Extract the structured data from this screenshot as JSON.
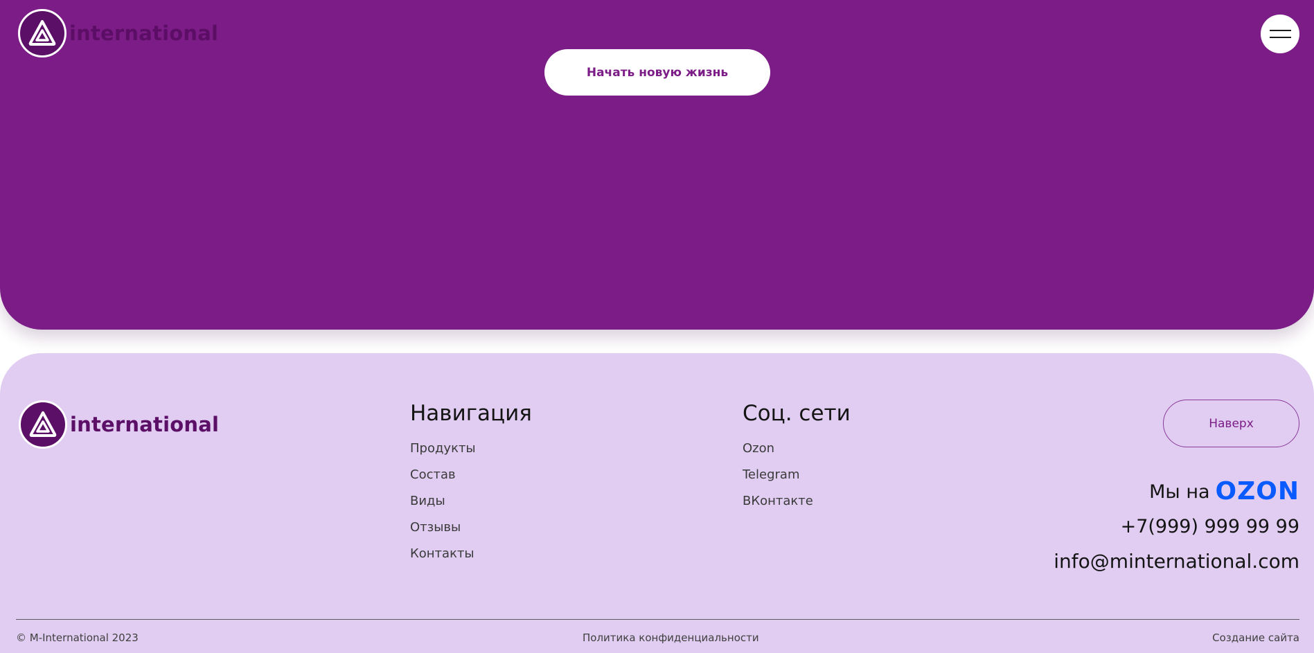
{
  "header": {
    "logo_text": "international",
    "menu_button_icon": "hamburger-icon"
  },
  "hero": {
    "cta_label": "Начать новую жизнь",
    "background_color": "#7c1d87"
  },
  "footer": {
    "logo_text": "international",
    "background_color": "#e0cdf1",
    "navigation": {
      "title": "Навигация",
      "items": [
        "Продукты",
        "Состав",
        "Виды",
        "Отзывы",
        "Контакты"
      ]
    },
    "social": {
      "title": "Соц. сети",
      "items": [
        "Ozon",
        "Telegram",
        "ВКонтакте"
      ]
    },
    "top_button_label": "Наверх",
    "ozon_prefix": "Мы на",
    "ozon_logo_text": "OZON",
    "phone": "+7(999) 999 99 99",
    "email": "info@minternational.com",
    "copyright": "© M-International 2023",
    "privacy_link": "Политика конфиденциальности",
    "site_credit": "Создание сайта"
  }
}
